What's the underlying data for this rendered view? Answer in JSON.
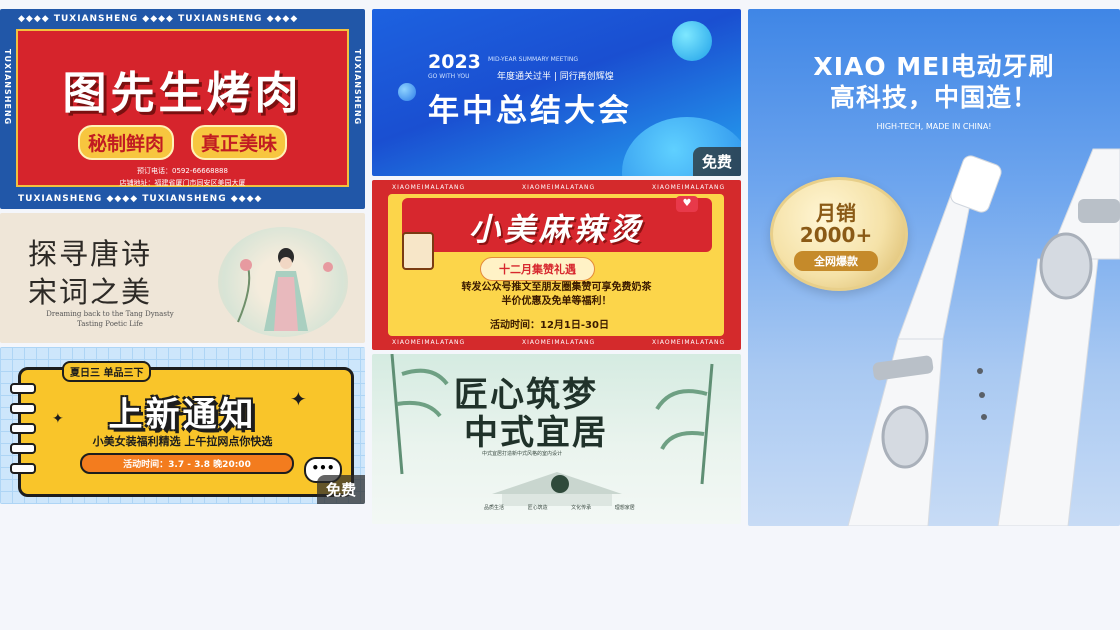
{
  "common": {
    "badge_free": "免费"
  },
  "cards": [
    {
      "strip_word": "TUXIANSHENG",
      "title": "图先生烤肉",
      "pills": [
        "秘制鲜肉",
        "真正美味"
      ],
      "info": [
        "预订电话：0592-66668888",
        "店铺地址：福建省厦门市同安区美园大厦"
      ]
    },
    {
      "title_line1": "探寻唐诗",
      "title_line2": "宋词之美",
      "subtitle_line1": "Dreaming back to the Tang Dynasty",
      "subtitle_line2": "Tasting Poetic Life"
    },
    {
      "tag": "夏日三 单品三下",
      "title": "上新通知",
      "desc": "小美女装福利精选 上午拉网点你快选",
      "time": "活动时间：3.7 - 3.8 晚20:00"
    },
    {
      "year": "2023",
      "en_line1": "MID-YEAR SUMMARY MEETING",
      "en_line2": "GO WITH YOU",
      "subtitle": "年度通关过半 | 同行再创辉煌",
      "title": "年中总结大会"
    },
    {
      "brand": "XIAOMEIMALATANG",
      "title": "小美麻辣烫",
      "pill": "十二月集赞礼遇",
      "line1": "转发公众号推文至朋友圈集赞可享免费奶茶",
      "line2": "半价优惠及免单等福利！",
      "time": "活动时间：12月1日-30日"
    },
    {
      "title_line1": "匠心筑梦",
      "title_line2": "中式宜居",
      "small": "中式宜居打造新中式风格的室内设计",
      "cols": "品质生活 匠心筑造 文化传承 理想家居"
    },
    {
      "title_line1": "XIAO MEI电动牙刷",
      "title_line2": "高科技，中国造！",
      "subtitle": "HIGH-TECH, MADE IN CHINA!",
      "medal_line1": "月销",
      "medal_line2": "2000+",
      "medal_line3": "全网爆款"
    }
  ]
}
